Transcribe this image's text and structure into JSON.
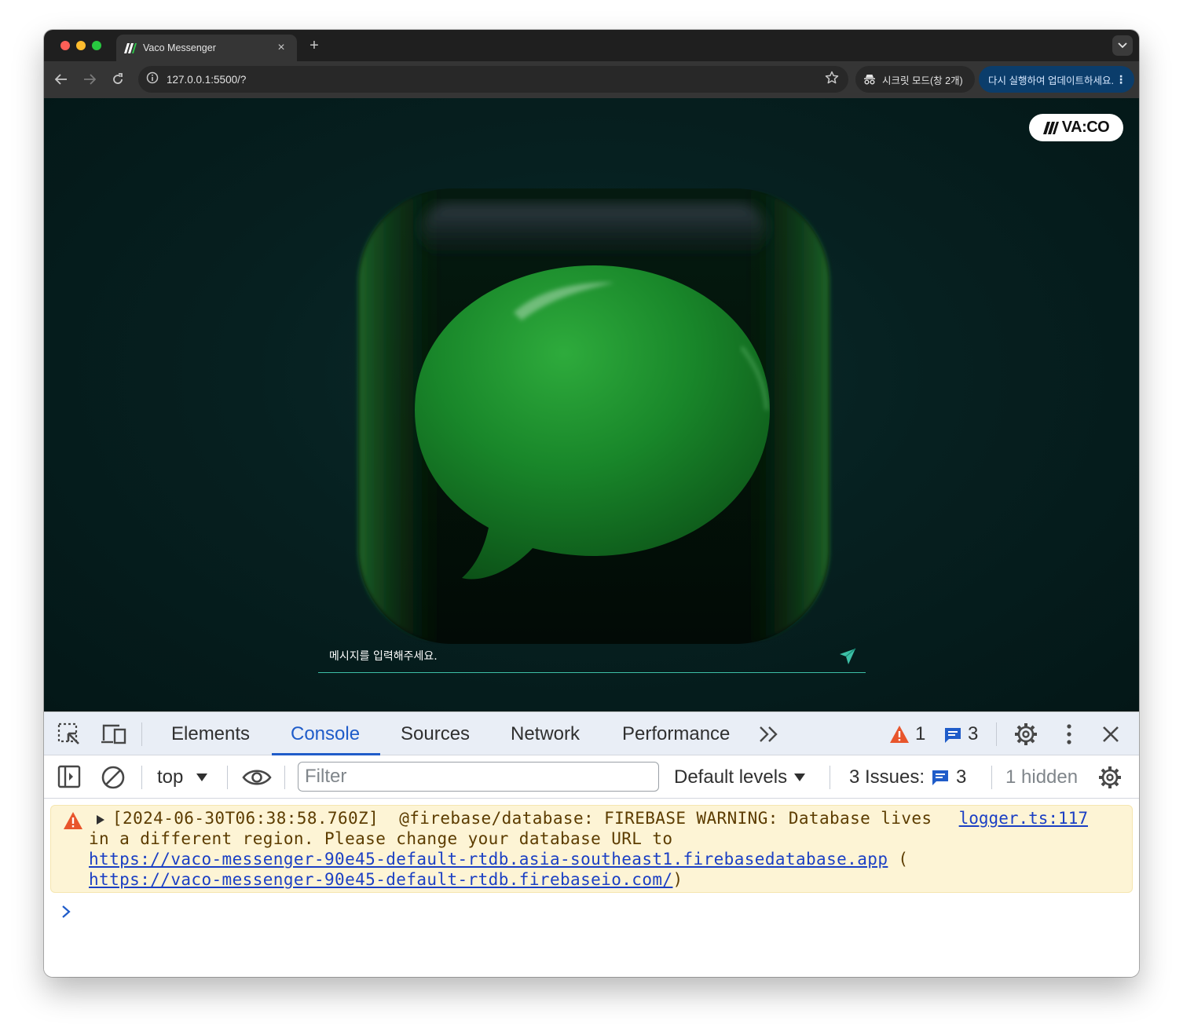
{
  "browser": {
    "tab_title": "Vaco Messenger",
    "url": "127.0.0.1:5500/?",
    "incognito_label": "시크릿 모드(창 2개)",
    "update_label": "다시 실행하여 업데이트하세요."
  },
  "page": {
    "logo_text": "VA:CO",
    "message_placeholder": "메시지를 입력해주세요.",
    "accent_color": "#3dbfa6",
    "bubble_color": "#1a8a2a",
    "background_color": "#062020"
  },
  "devtools": {
    "tabs": [
      "Elements",
      "Console",
      "Sources",
      "Network",
      "Performance"
    ],
    "active_tab": "Console",
    "warnings_count": "1",
    "messages_count": "3",
    "context": "top",
    "filter_placeholder": "Filter",
    "levels_label": "Default levels",
    "issues_label": "3 Issues:",
    "issues_count": "3",
    "hidden_label": "1 hidden",
    "console": {
      "line1": "[2024-06-30T06:38:58.760Z]  @firebase/database: FIREBASE WARNING: Database lives",
      "source": "logger.ts:117",
      "line2": "in a different region. Please change your database URL to",
      "url1": "https://vaco-messenger-90e45-default-rtdb.asia-southeast1.firebasedatabase.app",
      "url1_suffix": " (",
      "url2": "https://vaco-messenger-90e45-default-rtdb.firebaseio.com/",
      "url2_suffix": ")"
    }
  }
}
